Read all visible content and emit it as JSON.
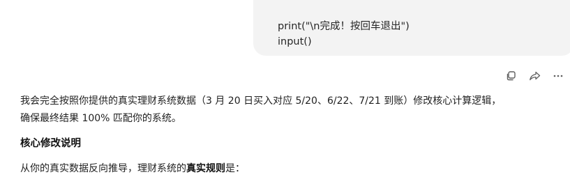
{
  "user_message": {
    "lines": [
      "print(\"\\n完成！按回车退出\")",
      "input()"
    ]
  },
  "toolbar": {
    "icons": [
      "copy-icon",
      "share-icon",
      "more-icon"
    ]
  },
  "assistant_message": {
    "intro_line1": "我会完全按照你提供的真实理财系统数据（3 月 20 日买入对应 5/20、6/22、7/21 到账）修改核心计算逻辑，",
    "intro_line2": "确保最终结果 100% 匹配你的系统。",
    "heading": "核心修改说明",
    "para_prefix": "从你的真实数据反向推导，理财系统的",
    "para_bold": "真实规则",
    "para_suffix": "是："
  }
}
